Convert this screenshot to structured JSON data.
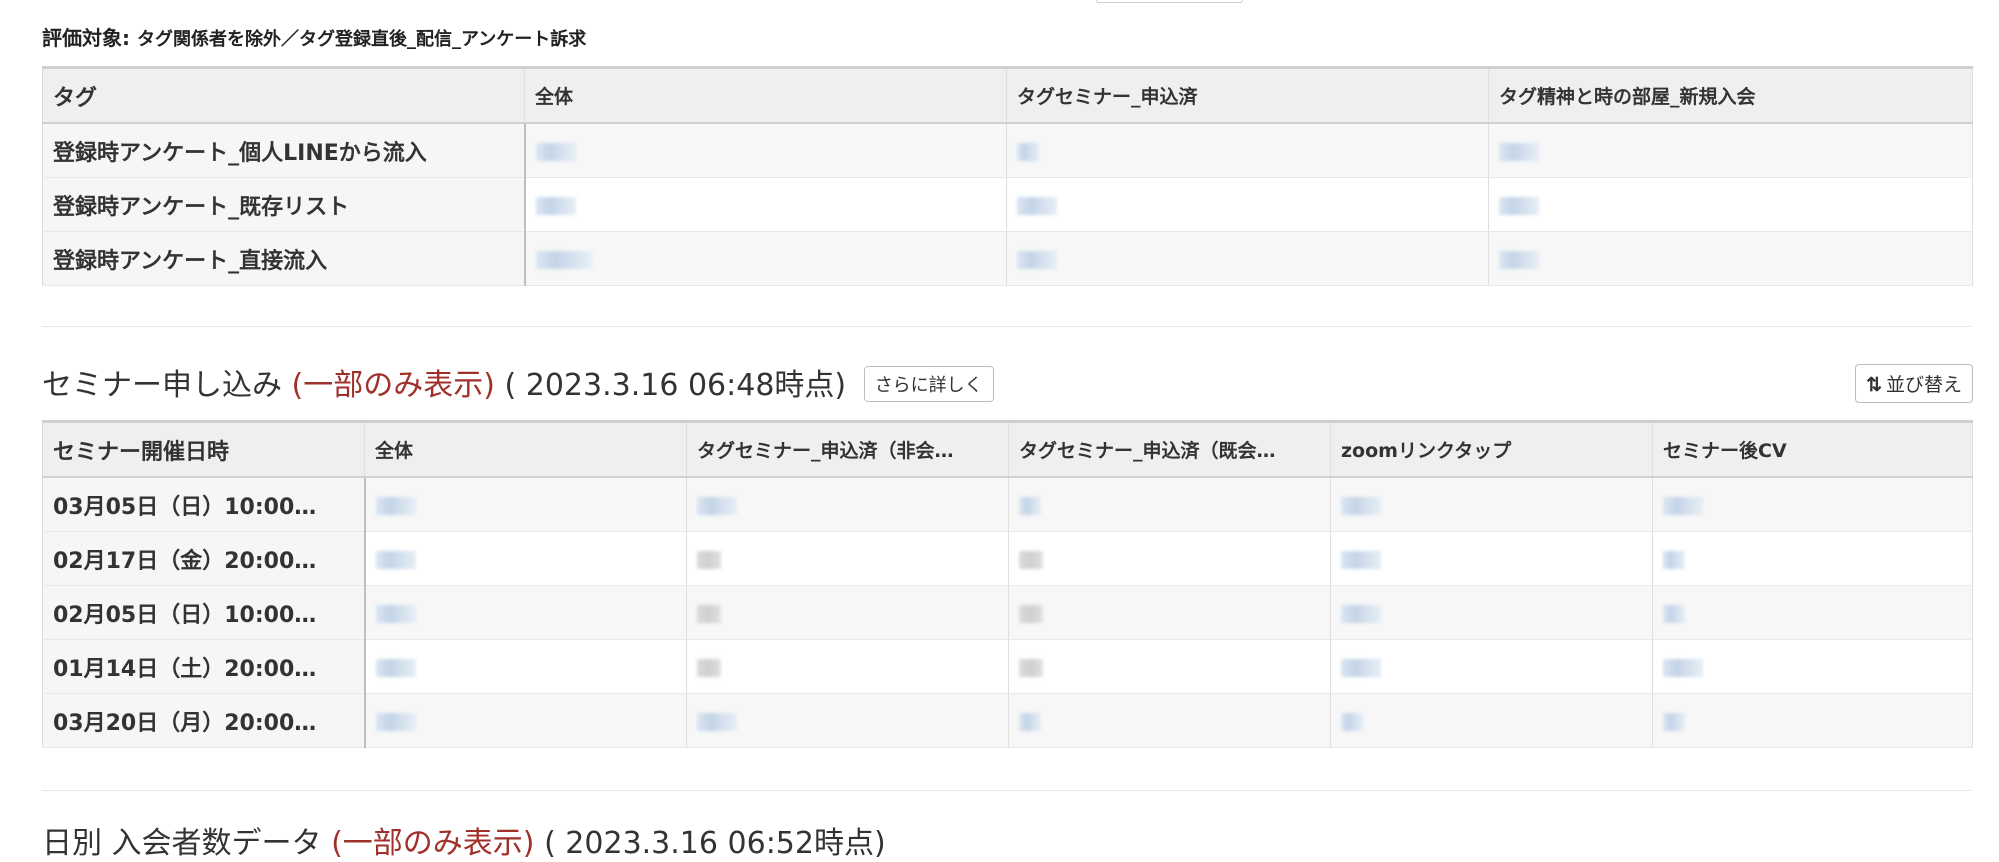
{
  "evaluation": {
    "label": "評価対象:",
    "value": "タグ関係者を除外／タグ登録直後_配信_アンケート訴求"
  },
  "tag_table": {
    "headers": [
      "タグ",
      "全体",
      "タグセミナー_申込済",
      "タグ精神と時の部屋_新規入会"
    ],
    "rows": [
      {
        "label": "登録時アンケート_個人LINEから流入"
      },
      {
        "label": "登録時アンケート_既存リスト"
      },
      {
        "label": "登録時アンケート_直接流入"
      }
    ]
  },
  "seminar_section": {
    "title": "セミナー申し込み",
    "partial_note": "(一部のみ表示)",
    "timestamp": "( 2023.3.16 06:48時点)",
    "detail_button": "さらに詳しく",
    "sort_button": "並び替え",
    "sort_icon": "sort-arrows-icon",
    "headers": [
      "セミナー開催日時",
      "全体",
      "タグセミナー_申込済（非会…",
      "タグセミナー_申込済（既会…",
      "zoomリンクタップ",
      "セミナー後CV"
    ],
    "rows": [
      {
        "date": "03月05日（日）10:00…"
      },
      {
        "date": "02月17日（金）20:00…"
      },
      {
        "date": "02月05日（日）10:00…"
      },
      {
        "date": "01月14日（土）20:00…"
      },
      {
        "date": "03月20日（月）20:00…"
      }
    ]
  },
  "next_section": {
    "title": "日別 入会者数データ",
    "partial_note": "(一部のみ表示)",
    "timestamp": "( 2023.3.16 06:52時点)"
  },
  "colors": {
    "accent_red": "#a0302a",
    "header_bg": "#efefef",
    "blurred_value": "#c3d4e8"
  }
}
